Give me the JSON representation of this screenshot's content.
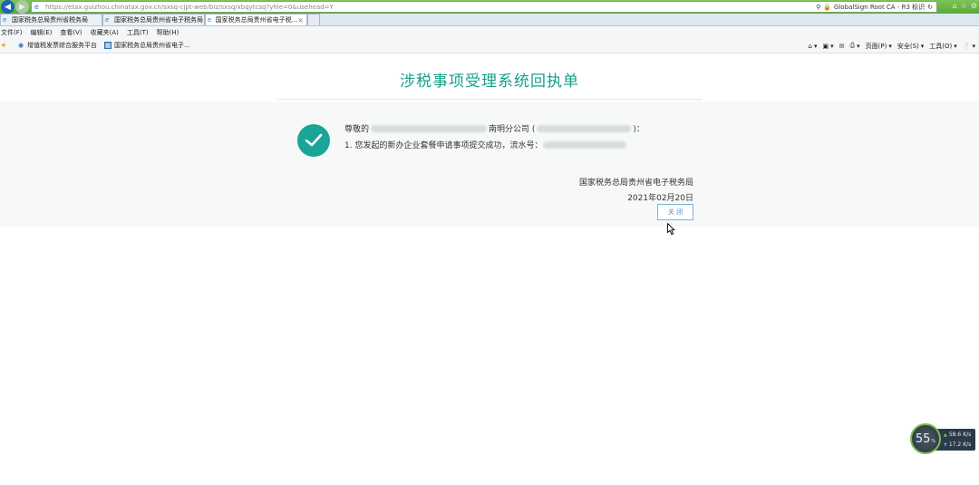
{
  "browser": {
    "url": "https://etax.guizhou.chinatax.gov.cn/sxsq-cjpt-web/biz/sxsq/xbqytcsq?yhle=0&usehead=Y",
    "cert": "GlobalSign Root CA - R3 标识",
    "tabs": [
      {
        "label": "国家税务总局贵州省税务局"
      },
      {
        "label": "国家税务总局贵州省电子税务局"
      },
      {
        "label": "国家税务总局贵州省电子税..."
      }
    ],
    "menu": [
      "文件(F)",
      "编辑(E)",
      "查看(V)",
      "收藏夹(A)",
      "工具(T)",
      "帮助(H)"
    ],
    "favorites": [
      {
        "label": "增值税发票综合服务平台"
      },
      {
        "label": "国家税务总局贵州省电子..."
      }
    ],
    "commands": {
      "page": "页面(P)",
      "safety": "安全(S)",
      "tools": "工具(O)"
    }
  },
  "page": {
    "title": "涉税事项受理系统回执单",
    "greeting_prefix": "尊敬的",
    "greeting_company": "南明分公司 (",
    "greeting_suffix": ")：",
    "message": "1. 您发起的新办企业套餐申请事项提交成功，流水号：",
    "issuer": "国家税务总局贵州省电子税务局",
    "date": "2021年02月20日",
    "close_label": "关 闭"
  },
  "speed_widget": {
    "percent": "55",
    "percent_unit": "%",
    "upload": "58.6",
    "upload_unit": "K/s",
    "download": "17.2",
    "download_unit": "K/s"
  },
  "colors": {
    "accent": "#14a08a",
    "check": "#1aa597",
    "button_border": "#7fb4d4"
  }
}
